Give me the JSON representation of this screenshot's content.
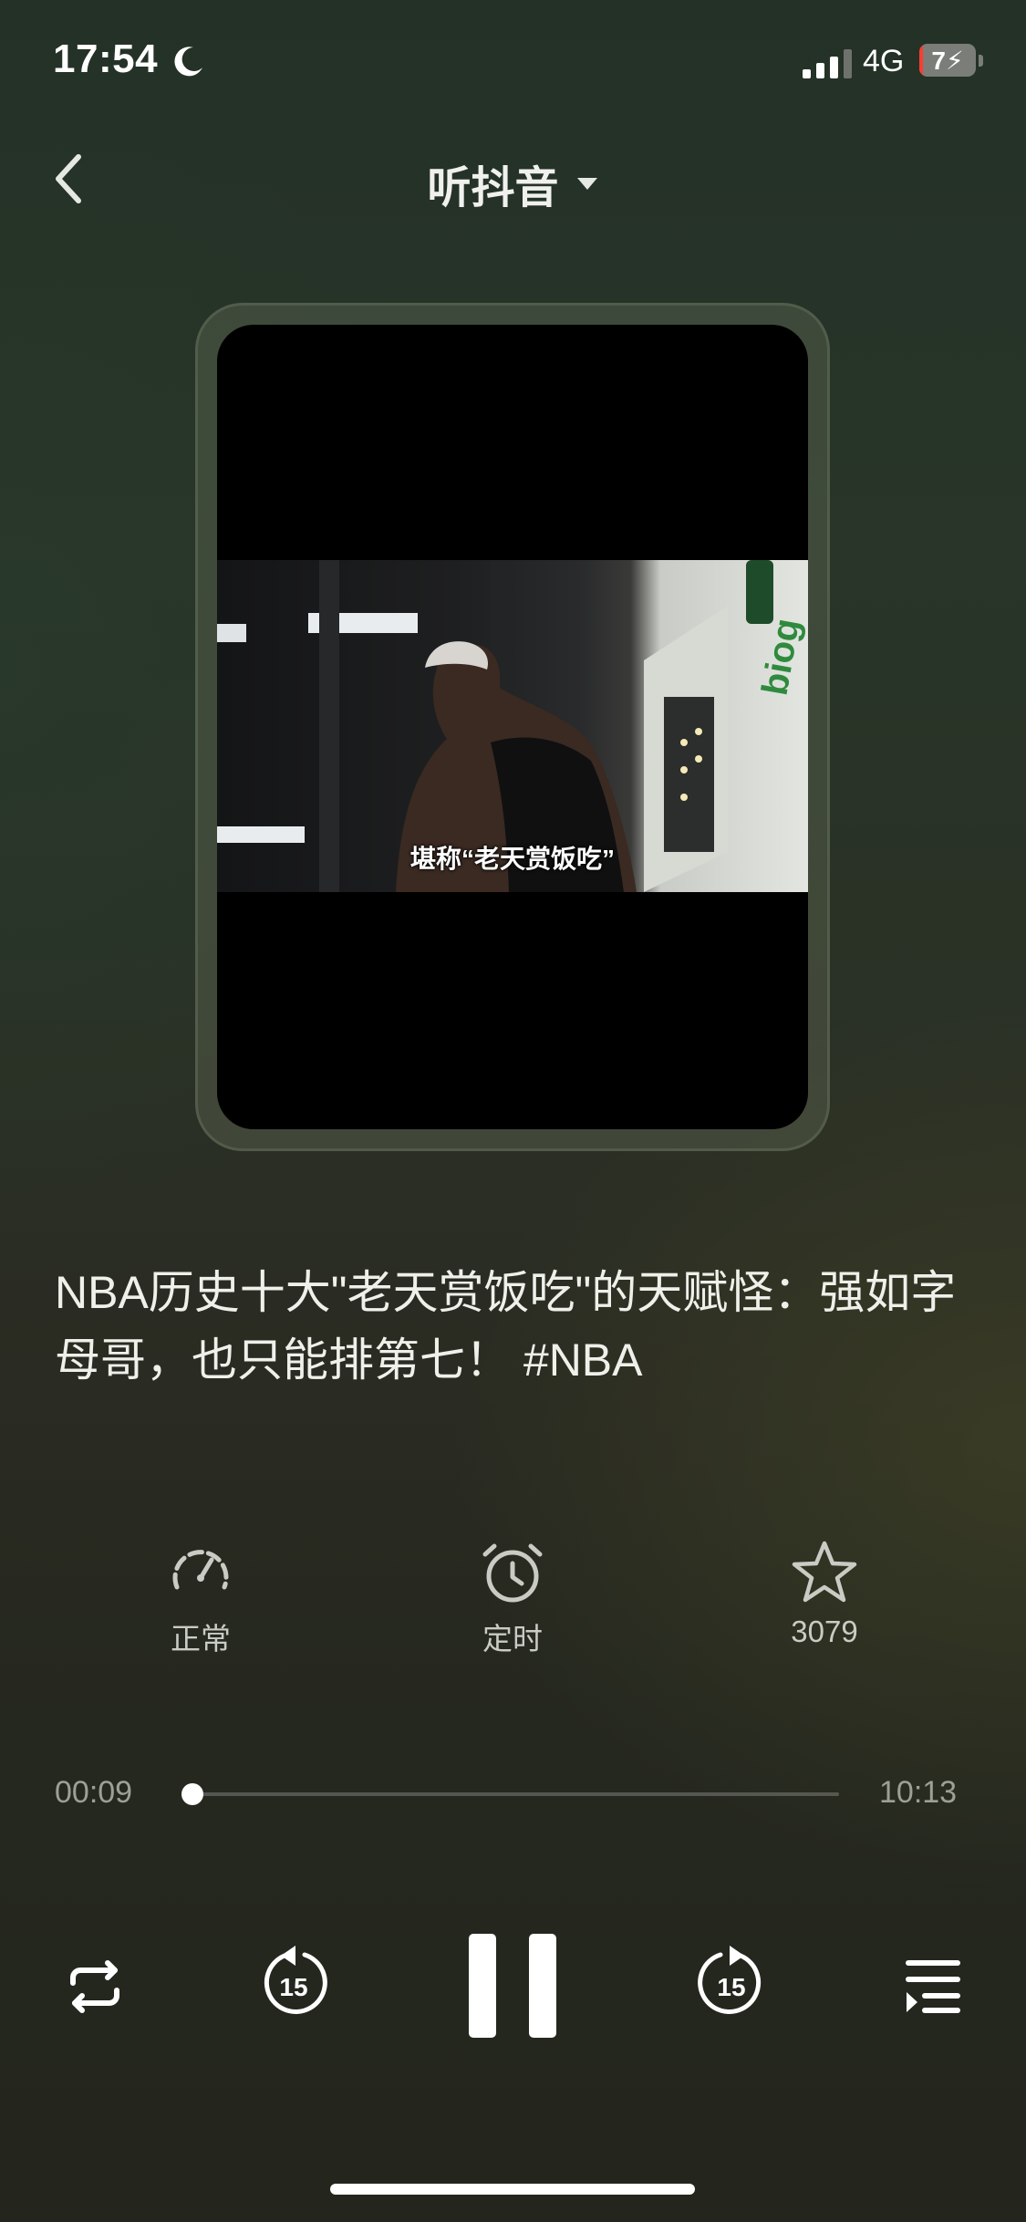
{
  "status_bar": {
    "time": "17:54",
    "network": "4G",
    "battery": "7",
    "battery_percent": 7,
    "signal_bars_active": 3
  },
  "header": {
    "title": "听抖音"
  },
  "video": {
    "subtitle": "堪称“老天赏饭吃”"
  },
  "description": "NBA历史十大\"老天赏饭吃\"的天赋怪：强如字母哥，也只能排第七！ #NBA",
  "actions": {
    "speed_label": "正常",
    "timer_label": "定时",
    "favorite_count": "3079"
  },
  "progress": {
    "current": "00:09",
    "total": "10:13",
    "fraction": 0.015
  },
  "controls": {
    "rewind_seconds": "15",
    "forward_seconds": "15"
  },
  "colors": {
    "accent": "#ffffff",
    "battery_low": "#ff3b30",
    "background": "#283528"
  },
  "icons": {
    "back": "chevron-left-icon",
    "dropdown": "caret-down-icon",
    "speed": "gauge-icon",
    "timer": "alarm-clock-icon",
    "favorite": "star-icon",
    "repeat": "repeat-icon",
    "rewind": "rewind-15-icon",
    "pause": "pause-icon",
    "forward": "forward-15-icon",
    "playlist": "playlist-icon"
  }
}
